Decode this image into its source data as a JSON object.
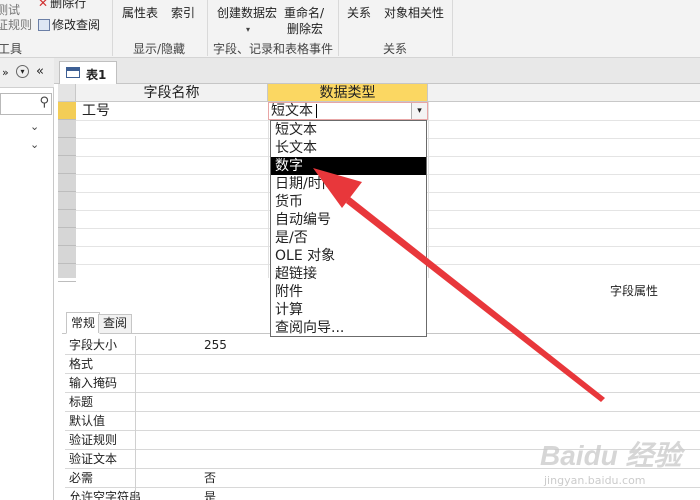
{
  "ribbon": {
    "items": {
      "test_rules_1": "测试",
      "test_rules_2": "证规则",
      "delete_rows": "删除行",
      "modify_lookup": "修改查阅",
      "property_sheet": "属性表",
      "indexes": "索引",
      "create_data_macros": "创建数据宏",
      "rename_delete_macro_1": "重命名/",
      "rename_delete_macro_2": "删除宏",
      "relationships": "关系",
      "object_dependencies": "对象相关性"
    },
    "groups": {
      "tools": "工具",
      "show_hide": "显示/隐藏",
      "field_record_table_events": "字段、记录和表格事件",
      "relationships": "关系"
    }
  },
  "nav": {
    "search_placeholder": ""
  },
  "document_tab": {
    "label": "表1"
  },
  "design_grid": {
    "headers": {
      "field_name": "字段名称",
      "data_type": "数据类型"
    },
    "rows": [
      {
        "field_name": "工号",
        "data_type": "短文本"
      }
    ]
  },
  "dropdown": {
    "options": [
      "短文本",
      "长文本",
      "数字",
      "日期/时间",
      "货币",
      "自动编号",
      "是/否",
      "OLE 对象",
      "超链接",
      "附件",
      "计算",
      "查阅向导..."
    ],
    "selected_index": 2
  },
  "field_properties": {
    "title": "字段属性",
    "tabs": [
      "常规",
      "查阅"
    ],
    "rows": [
      {
        "label": "字段大小",
        "value": "255"
      },
      {
        "label": "格式",
        "value": ""
      },
      {
        "label": "输入掩码",
        "value": ""
      },
      {
        "label": "标题",
        "value": ""
      },
      {
        "label": "默认值",
        "value": ""
      },
      {
        "label": "验证规则",
        "value": ""
      },
      {
        "label": "验证文本",
        "value": ""
      },
      {
        "label": "必需",
        "value": "否"
      },
      {
        "label": "允许空字符串",
        "value": "是"
      }
    ]
  },
  "annotation": {
    "arrow_color": "#e8373b"
  },
  "watermark": {
    "logo": "Baidu 经验",
    "sub": "jingyan.baidu.com"
  }
}
